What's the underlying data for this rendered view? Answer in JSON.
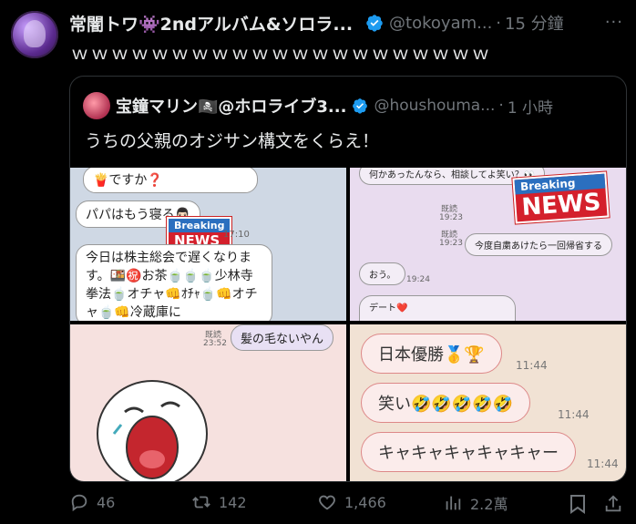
{
  "post": {
    "author_name": "常闇トワ👾2ndアルバム&ソロラ...",
    "handle": "@tokoyam...",
    "separator": "·",
    "time": "15 分鐘",
    "more": "···",
    "text": "ｗｗｗｗｗｗｗｗｗｗｗｗｗｗｗｗｗｗｗｗｗ"
  },
  "quote": {
    "author_name": "宝鐘マリン🏴‍☠️@ホロライブ3...",
    "handle": "@houshouma...",
    "separator": "·",
    "time": "1 小時",
    "text": "うちの父親のオジサン構文をくらえ！"
  },
  "images": {
    "img1": {
      "line1": "🍟ですか❓",
      "line2": "パパはもう寝る👨🏻",
      "time1": "17:10",
      "body": "今日は株主総会で遅くなります。🍱㊗️お茶🍵🍵🍵少林寺拳法🍵オチャ👊ｵﾁｬ🍵👊オチャ🍵👊冷蔵庫に",
      "news_top": "Breaking",
      "news_bot": "NEWS"
    },
    "img2": {
      "line1": "何かあったんなら、相談してよ笑い？👀",
      "r1": "既読",
      "t1": "19:23",
      "line2": "今度自粛あけたら一回帰省する",
      "r2": "既読",
      "t2": "19:23",
      "line3": "おう。",
      "t3": "19:24",
      "line4": "デート❤️",
      "news_top": "Breaking",
      "news_bot": "NEWS"
    },
    "img3": {
      "read": "既読",
      "time": "23:52",
      "bubble": "髪の毛ないやん"
    },
    "img4": {
      "b1": "日本優勝🥇🏆",
      "t1": "11:44",
      "b2": "笑い🤣🤣🤣🤣🤣",
      "t2": "11:44",
      "b3": "キャキャキャキャキャー",
      "t3": "11:44"
    }
  },
  "actions": {
    "replies": "46",
    "reposts": "142",
    "likes": "1,466",
    "views": "2.2萬"
  },
  "colors": {
    "background": "#000000",
    "text": "#e7e9ea",
    "muted": "#71767b",
    "verified": "#1d9bf0",
    "border": "#2f3336"
  }
}
